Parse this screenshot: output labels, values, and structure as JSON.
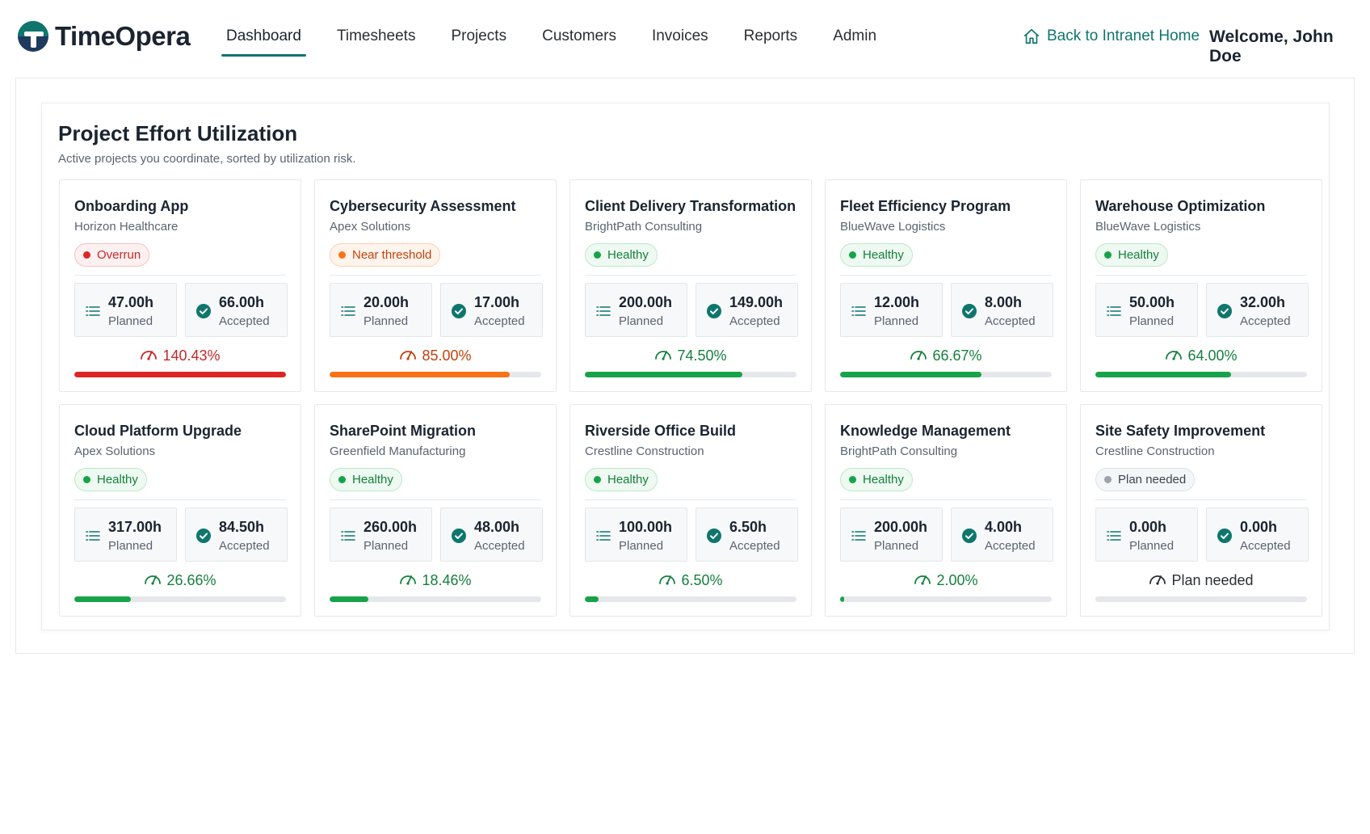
{
  "header": {
    "brand_name": "TimeOpera",
    "nav": [
      {
        "label": "Dashboard",
        "active": true
      },
      {
        "label": "Timesheets",
        "active": false
      },
      {
        "label": "Projects",
        "active": false
      },
      {
        "label": "Customers",
        "active": false
      },
      {
        "label": "Invoices",
        "active": false
      },
      {
        "label": "Reports",
        "active": false
      },
      {
        "label": "Admin",
        "active": false
      }
    ],
    "back_link": "Back to Intranet Home",
    "back_icon": "home-icon",
    "welcome": "Welcome, John Doe"
  },
  "section": {
    "title": "Project Effort Utilization",
    "subtitle": "Active projects you coordinate, sorted by utilization risk."
  },
  "colors": {
    "accent": "#0f766e",
    "overrun": "#dc2626",
    "near": "#f97316",
    "healthy": "#16a34a",
    "plan": "#9aa3ae"
  },
  "cards": [
    {
      "title": "Onboarding App",
      "customer": "Horizon Healthcare",
      "status": "Overrun",
      "status_type": "overrun",
      "planned": "47.00h",
      "planned_label": "Planned",
      "accepted": "66.00h",
      "accepted_label": "Accepted",
      "utilization": "140.43%",
      "utilization_value": 140.43,
      "tone": "red"
    },
    {
      "title": "Cybersecurity Assessment",
      "customer": "Apex Solutions",
      "status": "Near threshold",
      "status_type": "near",
      "planned": "20.00h",
      "planned_label": "Planned",
      "accepted": "17.00h",
      "accepted_label": "Accepted",
      "utilization": "85.00%",
      "utilization_value": 85.0,
      "tone": "orange"
    },
    {
      "title": "Client Delivery Transformation",
      "customer": "BrightPath Consulting",
      "status": "Healthy",
      "status_type": "healthy",
      "planned": "200.00h",
      "planned_label": "Planned",
      "accepted": "149.00h",
      "accepted_label": "Accepted",
      "utilization": "74.50%",
      "utilization_value": 74.5,
      "tone": "green"
    },
    {
      "title": "Fleet Efficiency Program",
      "customer": "BlueWave Logistics",
      "status": "Healthy",
      "status_type": "healthy",
      "planned": "12.00h",
      "planned_label": "Planned",
      "accepted": "8.00h",
      "accepted_label": "Accepted",
      "utilization": "66.67%",
      "utilization_value": 66.67,
      "tone": "green"
    },
    {
      "title": "Warehouse Optimization",
      "customer": "BlueWave Logistics",
      "status": "Healthy",
      "status_type": "healthy",
      "planned": "50.00h",
      "planned_label": "Planned",
      "accepted": "32.00h",
      "accepted_label": "Accepted",
      "utilization": "64.00%",
      "utilization_value": 64.0,
      "tone": "green"
    },
    {
      "title": "Cloud Platform Upgrade",
      "customer": "Apex Solutions",
      "status": "Healthy",
      "status_type": "healthy",
      "planned": "317.00h",
      "planned_label": "Planned",
      "accepted": "84.50h",
      "accepted_label": "Accepted",
      "utilization": "26.66%",
      "utilization_value": 26.66,
      "tone": "green"
    },
    {
      "title": "SharePoint Migration",
      "customer": "Greenfield Manufacturing",
      "status": "Healthy",
      "status_type": "healthy",
      "planned": "260.00h",
      "planned_label": "Planned",
      "accepted": "48.00h",
      "accepted_label": "Accepted",
      "utilization": "18.46%",
      "utilization_value": 18.46,
      "tone": "green"
    },
    {
      "title": "Riverside Office Build",
      "customer": "Crestline Construction",
      "status": "Healthy",
      "status_type": "healthy",
      "planned": "100.00h",
      "planned_label": "Planned",
      "accepted": "6.50h",
      "accepted_label": "Accepted",
      "utilization": "6.50%",
      "utilization_value": 6.5,
      "tone": "green"
    },
    {
      "title": "Knowledge Management",
      "customer": "BrightPath Consulting",
      "status": "Healthy",
      "status_type": "healthy",
      "planned": "200.00h",
      "planned_label": "Planned",
      "accepted": "4.00h",
      "accepted_label": "Accepted",
      "utilization": "2.00%",
      "utilization_value": 2.0,
      "tone": "green"
    },
    {
      "title": "Site Safety Improvement",
      "customer": "Crestline Construction",
      "status": "Plan needed",
      "status_type": "plan",
      "planned": "0.00h",
      "planned_label": "Planned",
      "accepted": "0.00h",
      "accepted_label": "Accepted",
      "utilization": "Plan needed",
      "utilization_value": 0,
      "tone": "gray"
    }
  ],
  "icons": {
    "planned": "list-icon",
    "accepted": "check-circle-icon",
    "utilization": "gauge-icon"
  }
}
